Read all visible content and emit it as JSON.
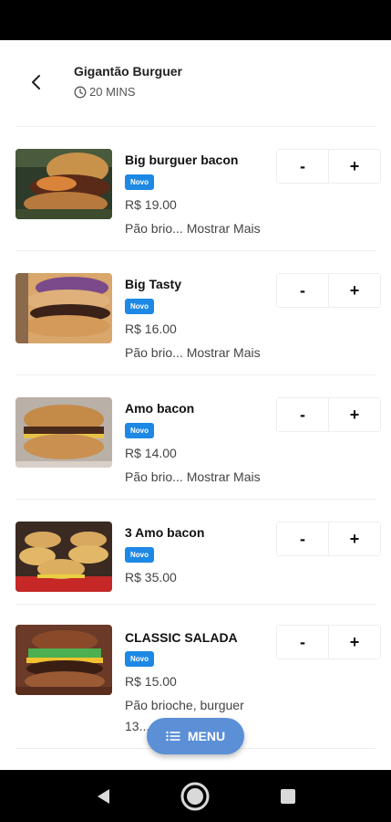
{
  "header": {
    "store_name": "Gigantão Burguer",
    "eta": "20 MINS"
  },
  "products": [
    {
      "name": "Big burguer bacon",
      "badge": "Novo",
      "price": "R$ 19.00",
      "desc_short": "Pão brio...",
      "more": "Mostrar Mais",
      "minus": "-",
      "plus": "+"
    },
    {
      "name": "Big Tasty",
      "badge": "Novo",
      "price": "R$ 16.00",
      "desc_short": "Pão brio...",
      "more": "Mostrar Mais",
      "minus": "-",
      "plus": "+"
    },
    {
      "name": "Amo bacon",
      "badge": "Novo",
      "price": "R$ 14.00",
      "desc_short": "Pão brio...",
      "more": "Mostrar Mais",
      "minus": "-",
      "plus": "+"
    },
    {
      "name": "3 Amo bacon",
      "badge": "Novo",
      "price": "R$ 35.00",
      "minus": "-",
      "plus": "+"
    },
    {
      "name": "CLASSIC SALADA",
      "badge": "Novo",
      "price": "R$ 15.00",
      "desc_line1": "Pão brioche, burguer",
      "desc_line2": "13...",
      "minus": "-",
      "plus": "+"
    }
  ],
  "fab": {
    "label": "MENU"
  },
  "colors": {
    "badge": "#1e88e5",
    "fab": "#5b8fd6"
  },
  "icons": {
    "back": "chevron-left-icon",
    "eta": "clock-icon",
    "fab": "list-icon"
  }
}
